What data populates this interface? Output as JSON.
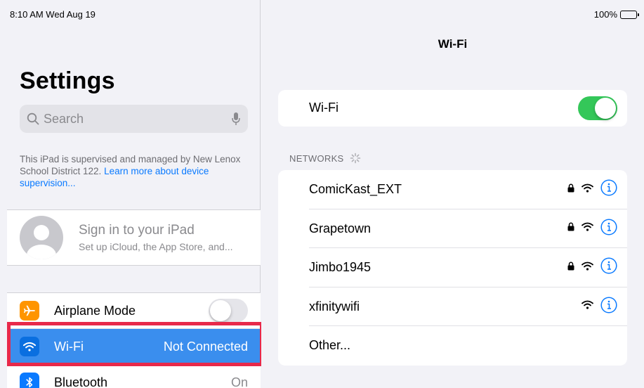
{
  "status": {
    "time": "8:10 AM   Wed Aug 19",
    "battery": "100%"
  },
  "sidebar": {
    "title": "Settings",
    "search_placeholder": "Search",
    "supervision_text": "This iPad is supervised and managed by New Lenox School District 122. ",
    "supervision_link": "Learn more about device supervision...",
    "sign_in_title": "Sign in to your iPad",
    "sign_in_subtitle": "Set up iCloud, the App Store, and...",
    "items": [
      {
        "label": "Airplane Mode",
        "value": "",
        "icon": "airplane-icon",
        "color": "#ff9500"
      },
      {
        "label": "Wi-Fi",
        "value": "Not Connected",
        "icon": "wifi-icon",
        "color": "#0a7aff"
      },
      {
        "label": "Bluetooth",
        "value": "On",
        "icon": "bluetooth-icon",
        "color": "#0a7aff"
      }
    ]
  },
  "detail": {
    "title": "Wi-Fi",
    "wifi_label": "Wi-Fi",
    "networks_header": "NETWORKS",
    "networks": [
      {
        "name": "ComicKast_EXT",
        "secured": true
      },
      {
        "name": "Grapetown",
        "secured": true
      },
      {
        "name": "Jimbo1945",
        "secured": true
      },
      {
        "name": "xfinitywifi",
        "secured": false
      },
      {
        "name": "Other...",
        "secured": false
      }
    ]
  },
  "colors": {
    "accent": "#0a7aff",
    "toggle_on": "#34c759",
    "highlight": "#e8294a"
  }
}
